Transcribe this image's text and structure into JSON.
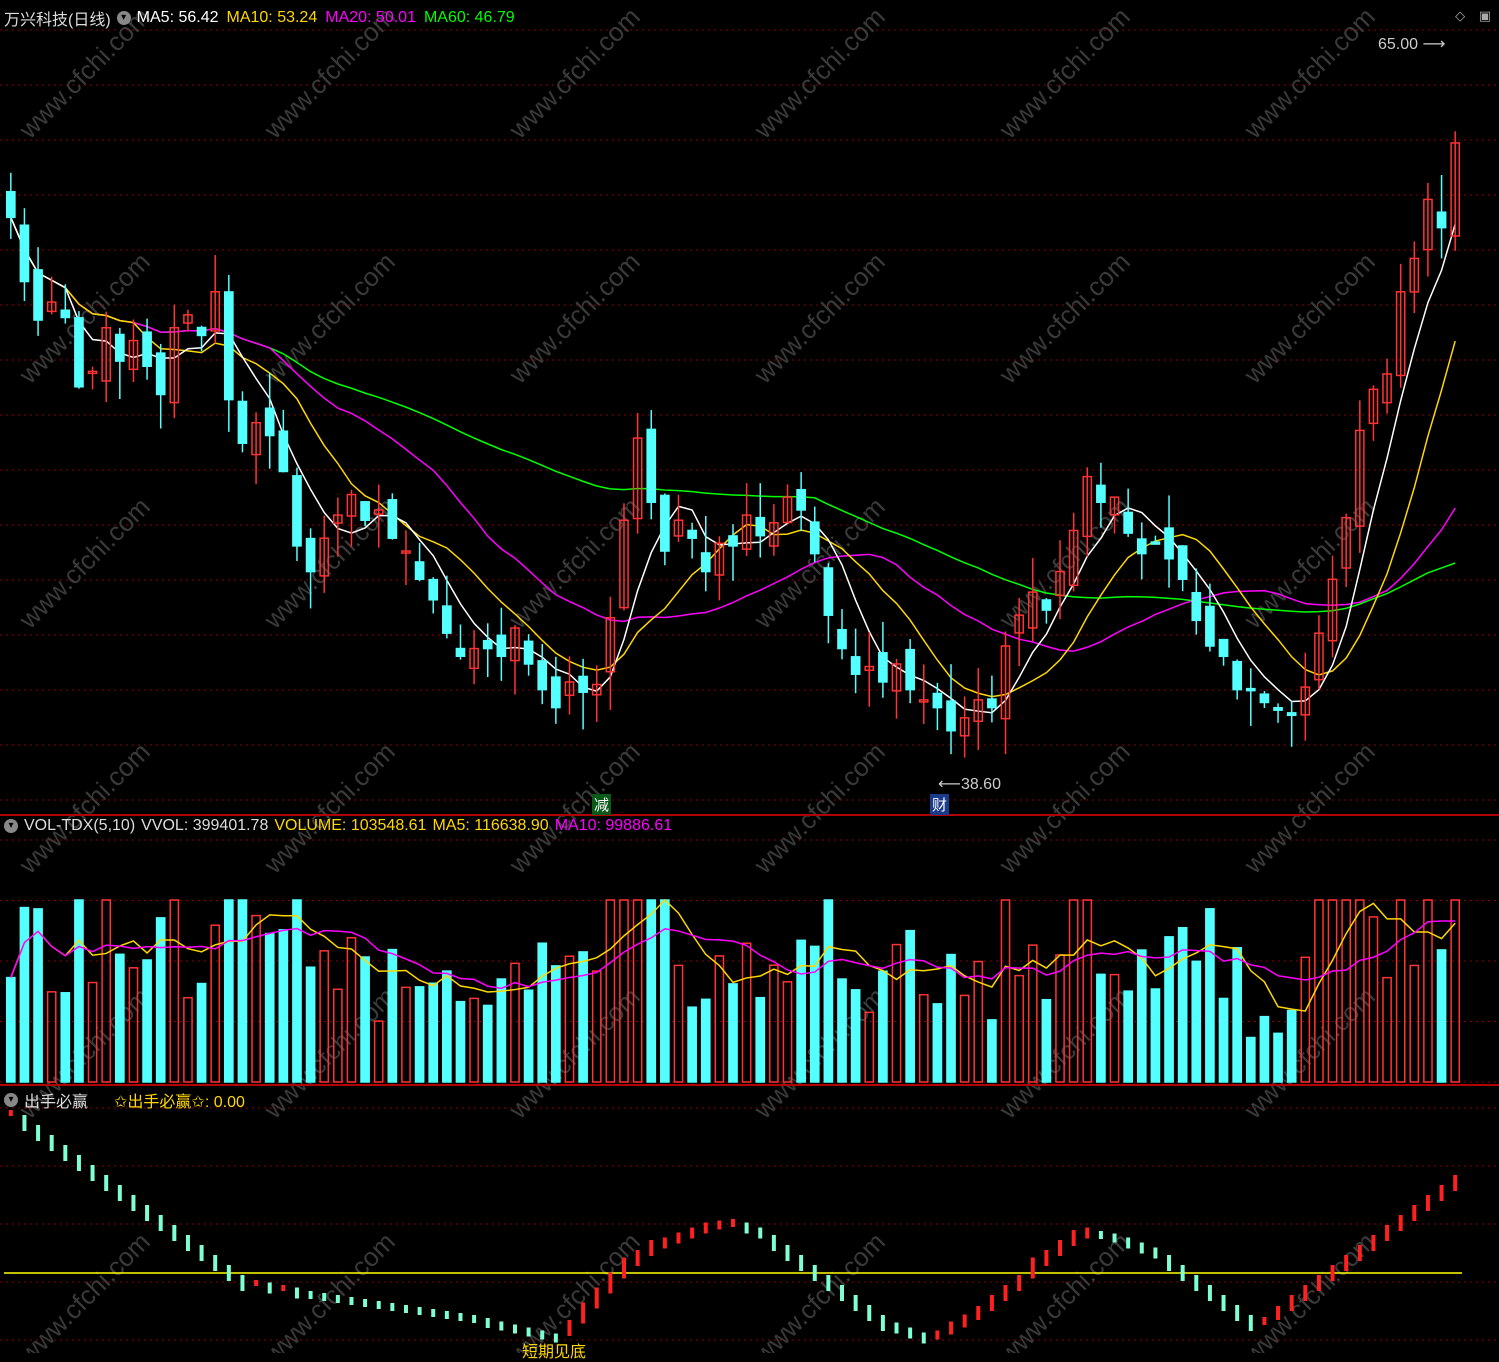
{
  "stock": {
    "name": "万兴科技(日线)"
  },
  "price_legend": [
    {
      "label": "MA5:",
      "value": "56.42",
      "color": "#ffffff"
    },
    {
      "label": "MA10:",
      "value": "53.24",
      "color": "#ffd700"
    },
    {
      "label": "MA20:",
      "value": "50.01",
      "color": "#ff00ff"
    },
    {
      "label": "MA60:",
      "value": "46.79",
      "color": "#00ff00"
    }
  ],
  "vol_legend": {
    "name": "VOL-TDX(5,10)",
    "vvol": "VVOL: 399401.78",
    "volume": "VOLUME: 103548.61",
    "ma5": "MA5: 116638.90",
    "ma10": "MA10: 99886.61"
  },
  "ind_legend": {
    "name": "出手必赢",
    "value": "✩出手必赢✩: 0.00"
  },
  "annotations": {
    "high": "65.00",
    "low": "38.60",
    "tag_reduce": "减",
    "tag_fin": "财",
    "bottom_label": "短期见底"
  },
  "colors": {
    "up": "#ff3333",
    "down": "#54ffff",
    "ma5": "#ffffff",
    "ma10": "#ffd700",
    "ma20": "#ff00ff",
    "ma60": "#00ff00",
    "grid": "#8b0000",
    "watermark": "#3a3a3a"
  },
  "watermark_text": "www.cfchi.com",
  "chart_data": {
    "type": "candlestick",
    "price_range": [
      37,
      67
    ],
    "closes": [
      59.7,
      57.2,
      55.7,
      56.4,
      55.8,
      53.1,
      53.7,
      55.4,
      54.1,
      54.9,
      53.9,
      52.8,
      55.4,
      55.9,
      55.1,
      56.8,
      52.6,
      50.9,
      51.7,
      51.2,
      49.8,
      46.9,
      45.9,
      47.2,
      48.1,
      48.9,
      47.9,
      48.3,
      47.2,
      46.7,
      45.6,
      44.8,
      43.5,
      42.6,
      42.9,
      42.9,
      42.6,
      43.7,
      42.3,
      41.3,
      40.6,
      41.6,
      41.2,
      41.5,
      44.1,
      47.9,
      51.1,
      48.6,
      46.7,
      47.9,
      47.2,
      45.9,
      47.0,
      46.9,
      48.1,
      47.3,
      47.8,
      48.8,
      48.3,
      46.6,
      44.2,
      42.9,
      41.9,
      42.2,
      41.6,
      42.3,
      41.3,
      40.9,
      40.6,
      39.7,
      40.2,
      40.9,
      40.6,
      43.0,
      44.2,
      45.1,
      44.4,
      45.9,
      47.5,
      49.6,
      48.6,
      48.8,
      47.4,
      46.6,
      47.0,
      46.4,
      45.6,
      44.0,
      43.0,
      42.6,
      41.3,
      41.3,
      40.8,
      40.5,
      40.3,
      41.4,
      43.5,
      45.6,
      48.0,
      51.4,
      53.0,
      53.6,
      56.8,
      58.1,
      60.4,
      59.3,
      62.6
    ],
    "indicator_values": [
      16,
      15,
      14,
      13,
      12,
      11,
      10,
      9,
      8,
      7,
      6,
      5,
      4,
      3,
      2,
      1,
      0,
      -1,
      -1,
      -1.5,
      -1.5,
      -2,
      -2.2,
      -2.4,
      -2.6,
      -2.8,
      -3,
      -3.2,
      -3.4,
      -3.6,
      -3.8,
      -4,
      -4.2,
      -4.4,
      -4.6,
      -5,
      -5.3,
      -5.6,
      -5.9,
      -6.2,
      -6.5,
      -5.5,
      -4,
      -2.5,
      -1,
      0.5,
      1.5,
      2.5,
      3,
      3.5,
      4,
      4.5,
      4.8,
      5,
      4.5,
      4,
      3,
      2,
      1,
      0,
      -1,
      -2,
      -3,
      -4,
      -5,
      -5.5,
      -6,
      -6.5,
      -6.2,
      -5.5,
      -4.8,
      -4,
      -3,
      -2,
      -1,
      0.5,
      1.5,
      2.5,
      3.5,
      4,
      3.8,
      3.5,
      3,
      2.5,
      2,
      1,
      0,
      -1,
      -2,
      -3,
      -4,
      -5,
      -4.8,
      -4,
      -3,
      -2,
      -1,
      0,
      1,
      2,
      3,
      4,
      5,
      6,
      7,
      8,
      9,
      10
    ]
  }
}
